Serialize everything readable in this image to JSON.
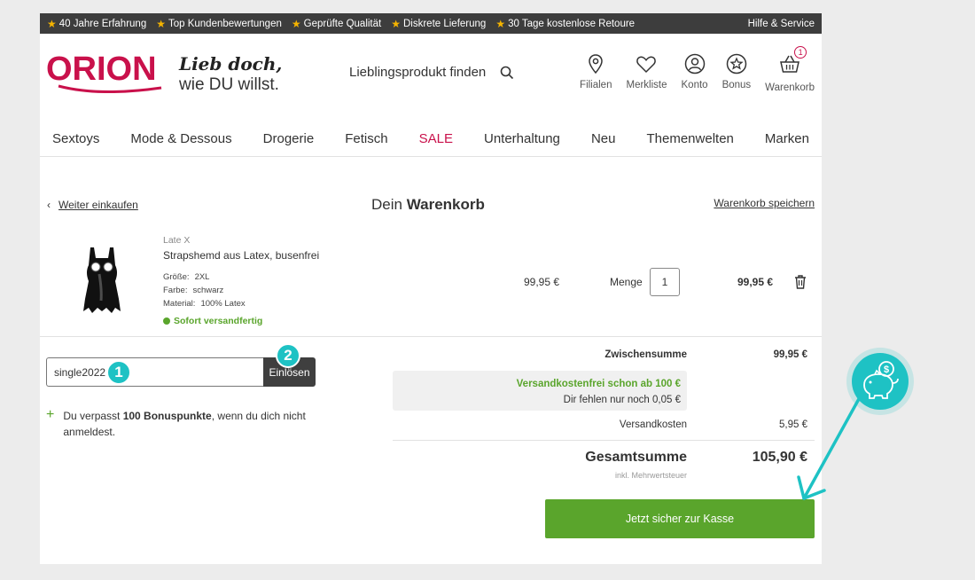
{
  "topbar": {
    "usps": [
      "40 Jahre Erfahrung",
      "Top Kundenbewertungen",
      "Geprüfte Qualität",
      "Diskrete Lieferung",
      "30 Tage kostenlose Retoure"
    ],
    "help": "Hilfe & Service"
  },
  "header": {
    "logo": "ORION",
    "slogan_line1": "Lieb doch,",
    "slogan_line2": "wie DU willst.",
    "search_label": "Lieblingsprodukt finden",
    "icons": [
      {
        "label": "Filialen",
        "icon": "location-pin-icon"
      },
      {
        "label": "Merkliste",
        "icon": "heart-icon"
      },
      {
        "label": "Konto",
        "icon": "user-icon"
      },
      {
        "label": "Bonus",
        "icon": "star-badge-icon"
      },
      {
        "label": "Warenkorb",
        "icon": "basket-icon"
      }
    ],
    "cart_count": "1"
  },
  "menu": [
    "Sextoys",
    "Mode & Dessous",
    "Drogerie",
    "Fetisch",
    "SALE",
    "Unterhaltung",
    "Neu",
    "Themenwelten",
    "Marken"
  ],
  "cart": {
    "back_link": "Weiter einkaufen",
    "title_prefix": "Dein",
    "title_bold": "Warenkorb",
    "save_link": "Warenkorb speichern",
    "item": {
      "brand": "Late X",
      "name": "Strapshemd aus Latex, busenfrei",
      "attributes": [
        {
          "key": "Größe:",
          "value": "2XL"
        },
        {
          "key": "Farbe:",
          "value": "schwarz"
        },
        {
          "key": "Material:",
          "value": "100% Latex"
        }
      ],
      "availability": "Sofort versandfertig",
      "unit_price": "99,95 €",
      "quantity_label": "Menge",
      "quantity": "1",
      "line_total": "99,95 €"
    },
    "voucher": {
      "code": "single2022",
      "button": "Einlösen"
    },
    "steps": [
      "1",
      "2"
    ],
    "bonus_prefix": "Du verpasst ",
    "bonus_bold": "100 Bonuspunkte",
    "bonus_suffix": ", wenn du dich nicht anmeldest.",
    "subtotal_label": "Zwischensumme",
    "subtotal_value": "99,95 €",
    "shipping_free_note": "Versandkostenfrei schon ab 100 €",
    "shipping_missing_note": "Dir fehlen nur noch 0,05 €",
    "shipping_label": "Versandkosten",
    "shipping_value": "5,95 €",
    "total_label": "Gesamtsumme",
    "total_value": "105,90 €",
    "vat_note": "inkl. Mehrwertsteuer",
    "checkout_button": "Jetzt sicher zur Kasse"
  },
  "colors": {
    "brand": "#c9114b",
    "green": "#5aa52c",
    "teal": "#1ec2c4",
    "topbar": "#3d3d3d"
  }
}
